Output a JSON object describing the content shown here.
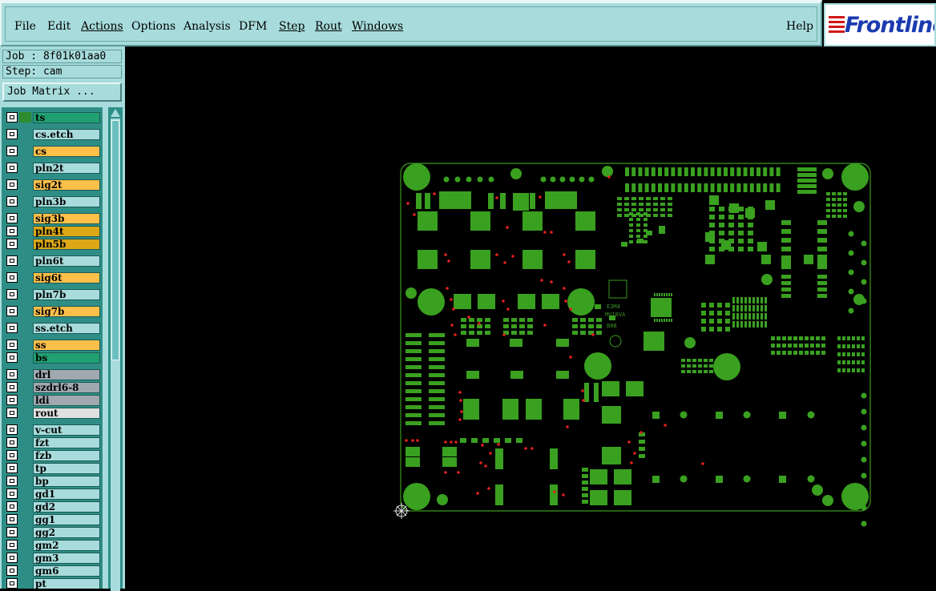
{
  "menubar": {
    "items": [
      "File",
      "Edit",
      "Actions",
      "Options",
      "Analysis",
      "DFM",
      "Step",
      "Rout",
      "Windows"
    ],
    "help": "Help"
  },
  "logo": {
    "text": "Frontline"
  },
  "job": {
    "line": "Job : 8f01k01aa0",
    "step_line": "Step: cam"
  },
  "job_matrix_button": "Job Matrix ...",
  "layers": [
    {
      "name": "ts",
      "color": "#20a070",
      "swatch": "#2e8b2e"
    },
    {
      "name": "cs.etch",
      "color": "#a8dcdc",
      "swatch": ""
    },
    {
      "name": "cs",
      "color": "#ffc04a",
      "swatch": ""
    },
    {
      "name": "pln2t",
      "color": "#a8dcdc",
      "swatch": ""
    },
    {
      "name": "sig2t",
      "color": "#ffc04a",
      "swatch": ""
    },
    {
      "name": "pln3b",
      "color": "#a8dcdc",
      "swatch": ""
    },
    {
      "name": "sig3b",
      "color": "#ffc04a",
      "swatch": ""
    },
    {
      "name": "pln4t",
      "color": "#dca818",
      "swatch": ""
    },
    {
      "name": "pln5b",
      "color": "#dca818",
      "swatch": ""
    },
    {
      "name": "pln6t",
      "color": "#a8dcdc",
      "swatch": ""
    },
    {
      "name": "sig6t",
      "color": "#ffc04a",
      "swatch": ""
    },
    {
      "name": "pln7b",
      "color": "#a8dcdc",
      "swatch": ""
    },
    {
      "name": "sig7b",
      "color": "#ffc04a",
      "swatch": ""
    },
    {
      "name": "ss.etch",
      "color": "#a8dcdc",
      "swatch": ""
    },
    {
      "name": "ss",
      "color": "#ffc04a",
      "swatch": ""
    },
    {
      "name": "bs",
      "color": "#20a070",
      "swatch": ""
    },
    {
      "name": "drl",
      "color": "#a0a8b0",
      "swatch": ""
    },
    {
      "name": "szdrl6-8",
      "color": "#a0a8b0",
      "swatch": ""
    },
    {
      "name": "ldi",
      "color": "#a0a8b0",
      "swatch": ""
    },
    {
      "name": "rout",
      "color": "#e0e0e0",
      "swatch": ""
    },
    {
      "name": "v-cut",
      "color": "#a8dcdc",
      "swatch": ""
    },
    {
      "name": "fzt",
      "color": "#a8dcdc",
      "swatch": ""
    },
    {
      "name": "fzb",
      "color": "#a8dcdc",
      "swatch": ""
    },
    {
      "name": "tp",
      "color": "#a8dcdc",
      "swatch": ""
    },
    {
      "name": "bp",
      "color": "#a8dcdc",
      "swatch": ""
    },
    {
      "name": "gd1",
      "color": "#a8dcdc",
      "swatch": ""
    },
    {
      "name": "gd2",
      "color": "#a8dcdc",
      "swatch": ""
    },
    {
      "name": "gg1",
      "color": "#a8dcdc",
      "swatch": ""
    },
    {
      "name": "gg2",
      "color": "#a8dcdc",
      "swatch": ""
    },
    {
      "name": "gm2",
      "color": "#a8dcdc",
      "swatch": ""
    },
    {
      "name": "gm3",
      "color": "#a8dcdc",
      "swatch": ""
    },
    {
      "name": "gm6",
      "color": "#a8dcdc",
      "swatch": ""
    },
    {
      "name": "pt",
      "color": "#a8dcdc",
      "swatch": ""
    }
  ],
  "colors": {
    "board_green": "#3a9a1e",
    "pad_green": "#3aa020",
    "red_via": "#e02020",
    "panel": "#a8dcdc",
    "background": "#000000"
  }
}
